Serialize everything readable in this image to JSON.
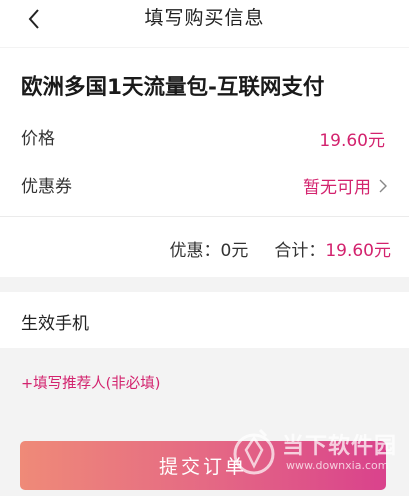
{
  "header": {
    "title": "填写购买信息",
    "back_icon": "chevron-left-icon"
  },
  "product": {
    "title": "欧洲多国1天流量包-互联网支付",
    "price_label": "价格",
    "price_value": "19.60元",
    "coupon_label": "优惠券",
    "coupon_value": "暂无可用",
    "coupon_icon": "chevron-right-icon"
  },
  "summary": {
    "discount_label": "优惠：",
    "discount_value": "0元",
    "total_label": "合计：",
    "total_value": "19.60元"
  },
  "phone": {
    "label": "生效手机"
  },
  "referrer": {
    "link": "+填写推荐人(非必填)"
  },
  "submit": {
    "label": "提交订单"
  },
  "watermark": {
    "cn": "当下软件园",
    "url": "www.downxia.com"
  },
  "colors": {
    "accent": "#d3236e",
    "button_start": "#ef8a78",
    "button_end": "#d9428c",
    "background": "#f3f3f3"
  }
}
